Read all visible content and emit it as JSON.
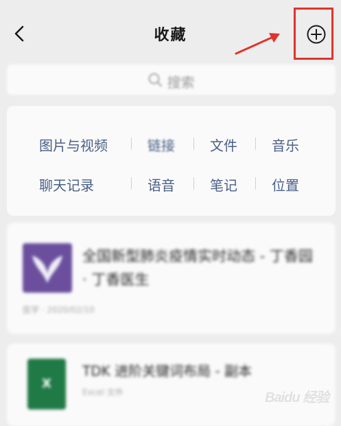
{
  "nav": {
    "title": "收藏",
    "back_icon": "chevron-left-icon",
    "add_icon": "plus-circle-icon"
  },
  "annotation": {
    "highlight_color": "#e0332b"
  },
  "search": {
    "placeholder": "搜索",
    "icon": "search-icon"
  },
  "categories": [
    {
      "label": "图片与视频"
    },
    {
      "label": "链接"
    },
    {
      "label": "文件"
    },
    {
      "label": "音乐"
    },
    {
      "label": "聊天记录"
    },
    {
      "label": "语音"
    },
    {
      "label": "笔记"
    },
    {
      "label": "位置"
    }
  ],
  "items": [
    {
      "title": "全国新型肺炎疫情实时动态 - 丁香园 · 丁香医生",
      "meta": "医学 · 2020/02/10",
      "thumb_icon": "butterfly-logo-icon",
      "thumb_color": "#6b4f9e"
    },
    {
      "title": "TDK 进阶关键词布局 - 副本",
      "meta": "Excel 文件",
      "thumb_icon": "excel-file-icon",
      "thumb_color": "#1f7a46"
    }
  ],
  "watermark": {
    "text": "Baidu 经验"
  }
}
